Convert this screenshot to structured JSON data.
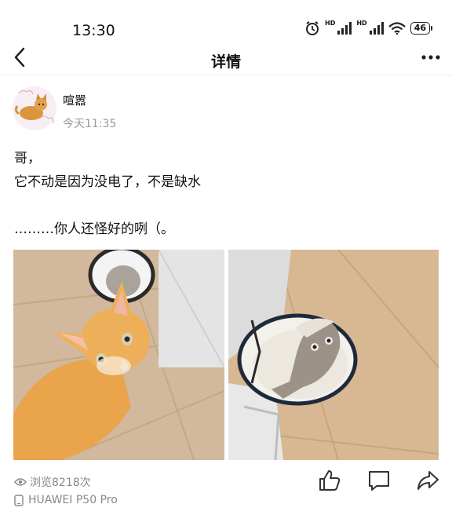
{
  "status_bar": {
    "time": "13:30",
    "battery": "46",
    "hd1": "HD",
    "hd2": "HD"
  },
  "nav": {
    "title": "详情"
  },
  "post": {
    "author": "喧嚣",
    "time": "今天11:35",
    "lines": [
      "哥，",
      "它不动是因为没电了，不是缺水",
      "",
      "………你人还怪好的咧（。"
    ],
    "views": "浏览8218次",
    "device": "HUAWEI P50 Pro"
  },
  "icons": {
    "back": "back-arrow-icon",
    "more": "more-icon",
    "alarm": "alarm-icon",
    "signal": "signal-icon",
    "wifi": "wifi-icon",
    "eye": "eye-icon",
    "phone": "phone-icon",
    "like": "thumbs-up-icon",
    "comment": "comment-icon",
    "share": "share-icon"
  },
  "colors": {
    "text": "#111111",
    "secondary": "#999999",
    "divider": "#ececec"
  }
}
